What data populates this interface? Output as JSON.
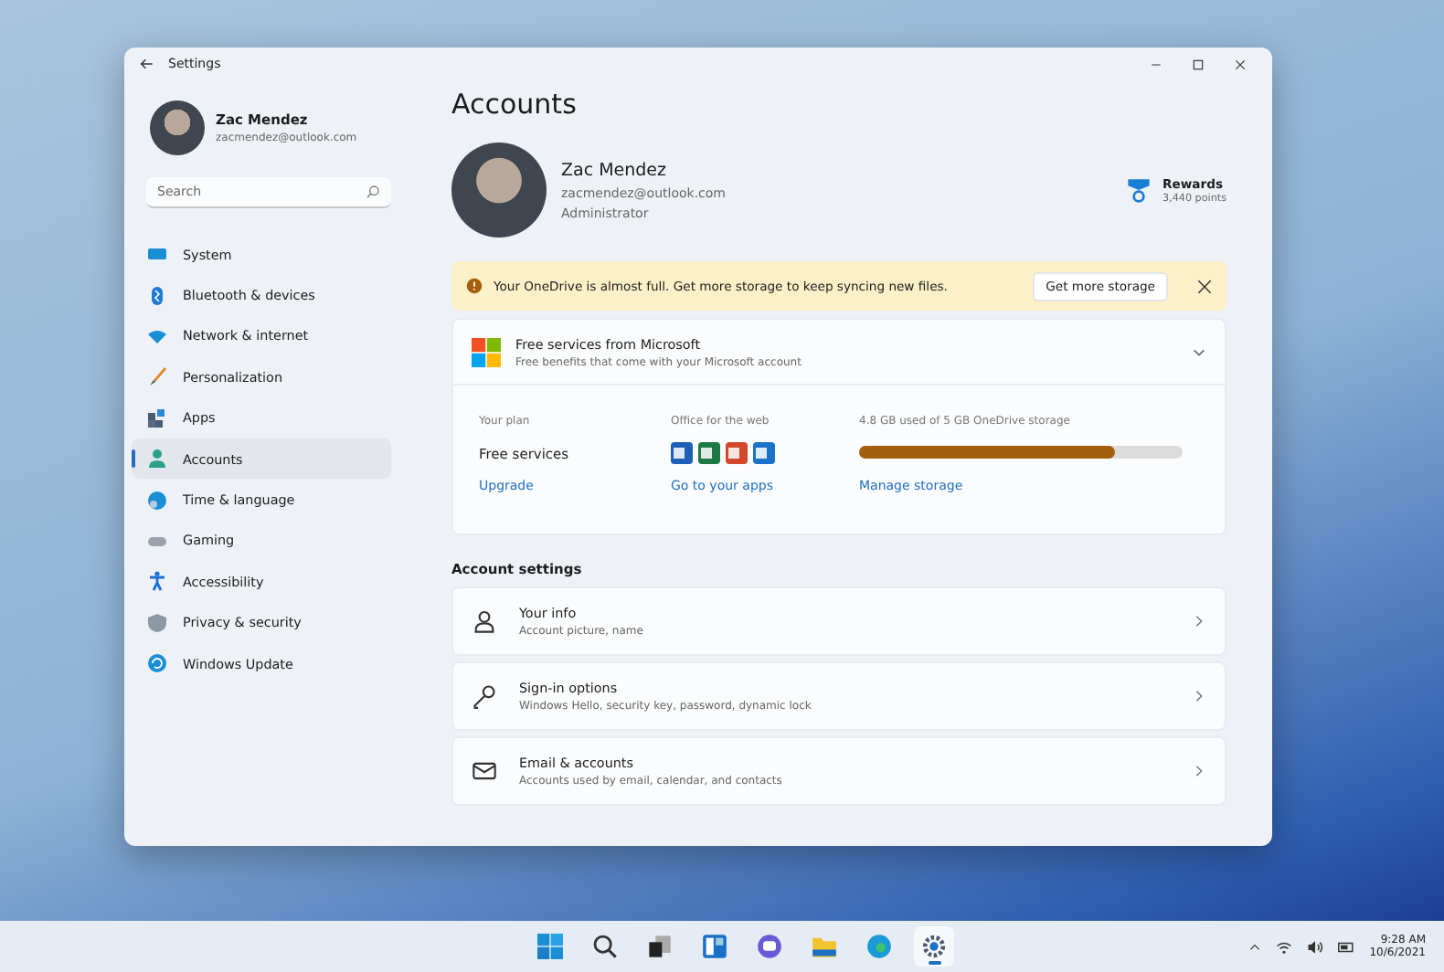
{
  "window": {
    "title": "Settings"
  },
  "sidebar": {
    "user": {
      "name": "Zac Mendez",
      "email": "zacmendez@outlook.com"
    },
    "search": {
      "placeholder": "Search"
    },
    "items": [
      {
        "label": "System",
        "selected": false
      },
      {
        "label": "Bluetooth & devices",
        "selected": false
      },
      {
        "label": "Network & internet",
        "selected": false
      },
      {
        "label": "Personalization",
        "selected": false
      },
      {
        "label": "Apps",
        "selected": false
      },
      {
        "label": "Accounts",
        "selected": true
      },
      {
        "label": "Time & language",
        "selected": false
      },
      {
        "label": "Gaming",
        "selected": false
      },
      {
        "label": "Accessibility",
        "selected": false
      },
      {
        "label": "Privacy & security",
        "selected": false
      },
      {
        "label": "Windows Update",
        "selected": false
      }
    ]
  },
  "page": {
    "title": "Accounts",
    "profile": {
      "name": "Zac Mendez",
      "email": "zacmendez@outlook.com",
      "role": "Administrator"
    },
    "rewards": {
      "label": "Rewards",
      "points": "3,440 points"
    },
    "banner": {
      "message": "Your OneDrive is almost full. Get more storage to keep syncing new files.",
      "button": "Get more storage"
    },
    "services": {
      "title": "Free services from Microsoft",
      "subtitle": "Free benefits that come with your Microsoft account",
      "expanded": true,
      "columns": [
        {
          "kind": "text",
          "heading": "Your plan",
          "value": "Free services",
          "link": "Upgrade"
        },
        {
          "kind": "apps",
          "heading": "Office for the web",
          "link": "Go to your apps"
        },
        {
          "kind": "meter",
          "heading": "4.8 GB used of 5 GB OneDrive storage",
          "level": 0.79,
          "link": "Manage storage"
        }
      ]
    },
    "settings_heading": "Account settings",
    "settings": [
      {
        "title": "Your info",
        "subtitle": "Account picture, name"
      },
      {
        "title": "Sign-in options",
        "subtitle": "Windows Hello, security key, password, dynamic lock"
      },
      {
        "title": "Email & accounts",
        "subtitle": "Accounts used by email, calendar, and contacts"
      }
    ]
  },
  "taskbar": {
    "apps": [
      {
        "selected": false
      },
      {
        "selected": false
      },
      {
        "selected": false
      },
      {
        "selected": false
      },
      {
        "selected": false
      },
      {
        "selected": false
      },
      {
        "selected": false
      },
      {
        "selected": true
      }
    ],
    "time": "9:28 AM",
    "date": "10/6/2021"
  }
}
